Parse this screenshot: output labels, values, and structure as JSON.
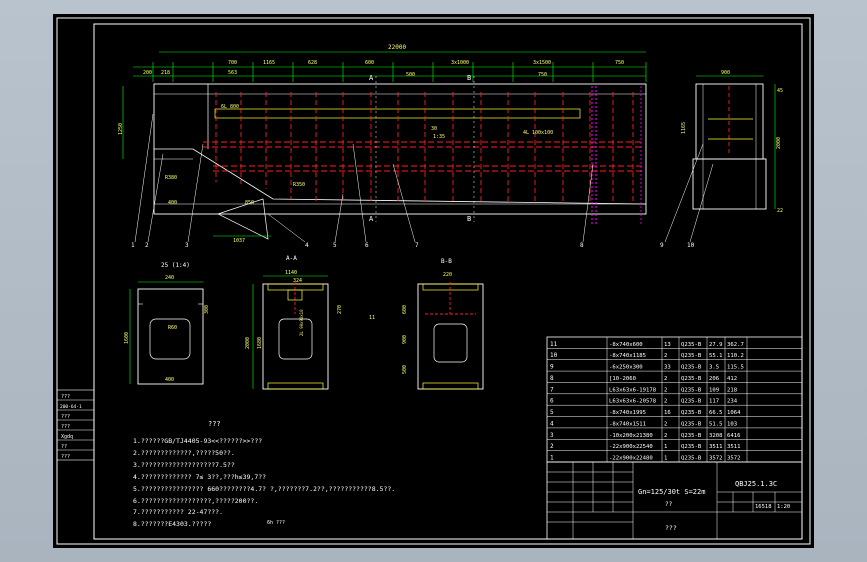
{
  "drawing": {
    "top_dims": {
      "overall": "22000",
      "d1": "200",
      "d2": "218",
      "d3": "700",
      "d4": "1165",
      "d5": "563",
      "d6": "628",
      "d7": "600",
      "d8": "3x1000",
      "d9": "500",
      "d10": "3x1500",
      "d11": "750",
      "d12": "750"
    },
    "side_labels": {
      "h1": "1250",
      "r1": "R380",
      "d400": "400",
      "ang": "6L 800",
      "r2": "R350",
      "hopper_w": "1037",
      "hopper_d": "850",
      "note1": "4L 100x100",
      "slope": "1:35",
      "s30": "30"
    },
    "section_marks": {
      "a_top": "A",
      "a_bot": "A",
      "b_top": "B",
      "b_bot": "B"
    },
    "end_view": {
      "w": "900",
      "h1": "2000",
      "h2": "1165",
      "d1": "45",
      "d2": "22"
    },
    "callouts": [
      "1",
      "2",
      "3",
      "4",
      "5",
      "6",
      "7",
      "8",
      "9",
      "10"
    ],
    "views": {
      "v25": "25 (1:4)",
      "aa": "A-A",
      "bb": "B-B"
    },
    "v25_dims": {
      "w": "240",
      "h": "1600",
      "d": "300",
      "r": "R60",
      "b": "400"
    },
    "aa_dims": {
      "w1": "1140",
      "w2": "324",
      "h": "2000",
      "h2": "1680",
      "d": "270",
      "note": "2L 90x90x10"
    },
    "bb_dims": {
      "w": "220",
      "h1": "600",
      "h2": "900",
      "h3": "500",
      "d": "11"
    },
    "notes_title": "???",
    "notes": [
      "1.??????GB/TJ4405-93<<??????>>???",
      "2.?????????????,?????50??.",
      "3.???????????????????7.5??",
      "4.?????????????     7≤ 3??,???h≤39,7??",
      "5.????????????????      660????????4.7?    ?,???????7.2??,???????????8.5??.",
      "6.??????????????????,?????200??.",
      "7.???????????          22-47???.",
      "8.???????E4303.?????"
    ],
    "weld_note": "6h ???",
    "stamp": {
      "r1": "???",
      "r2": "200-64-1",
      "r3": "???",
      "r4": "???",
      "r5": "Xgdq",
      "r6": "??",
      "r7": "???"
    }
  },
  "bom": {
    "rows": [
      {
        "no": "11",
        "spec": "-8x740x600",
        "qty": "13",
        "mat": "Q235-B",
        "w1": "27.9",
        "w2": "362.7"
      },
      {
        "no": "10",
        "spec": "-8x740x1185",
        "qty": "2",
        "mat": "Q235-B",
        "w1": "55.1",
        "w2": "110.2"
      },
      {
        "no": "9",
        "spec": "-6x250x300",
        "qty": "33",
        "mat": "Q235-B",
        "w1": "3.5",
        "w2": "115.5"
      },
      {
        "no": "8",
        "spec": "[10-2060",
        "qty": "2",
        "mat": "Q235-B",
        "w1": "206",
        "w2": "412"
      },
      {
        "no": "7",
        "spec": "L63x63x6-19178",
        "qty": "2",
        "mat": "Q235-B",
        "w1": "109",
        "w2": "218"
      },
      {
        "no": "6",
        "spec": "L63x63x6-20578",
        "qty": "2",
        "mat": "Q235-B",
        "w1": "117",
        "w2": "234"
      },
      {
        "no": "5",
        "spec": "-8x740x1995",
        "qty": "16",
        "mat": "Q235-B",
        "w1": "66.5",
        "w2": "1064"
      },
      {
        "no": "4",
        "spec": "-8x740x1511",
        "qty": "2",
        "mat": "Q235-B",
        "w1": "51.5",
        "w2": "103"
      },
      {
        "no": "3",
        "spec": "-10x200x21380",
        "qty": "2",
        "mat": "Q235-B",
        "w1": "3208",
        "w2": "6416"
      },
      {
        "no": "2",
        "spec": "-22x900x22540",
        "qty": "1",
        "mat": "Q235-B",
        "w1": "3511",
        "w2": "3511"
      },
      {
        "no": "1",
        "spec": "-22x900x22480",
        "qty": "1",
        "mat": "Q235-B",
        "w1": "3572",
        "w2": "3572"
      }
    ],
    "title_left": "Gn=125/30t  S=22m",
    "title_sub": "??",
    "code": "QBJ25.1.3C",
    "weight": "16518",
    "scale": "1:20",
    "company": "???"
  },
  "colors": {
    "bg": "#000000",
    "line": "#ffffff",
    "cyan": "#00ffff",
    "yellow": "#ffff33",
    "green": "#00ff00",
    "red": "#ff2020",
    "magenta": "#ff00ff"
  }
}
